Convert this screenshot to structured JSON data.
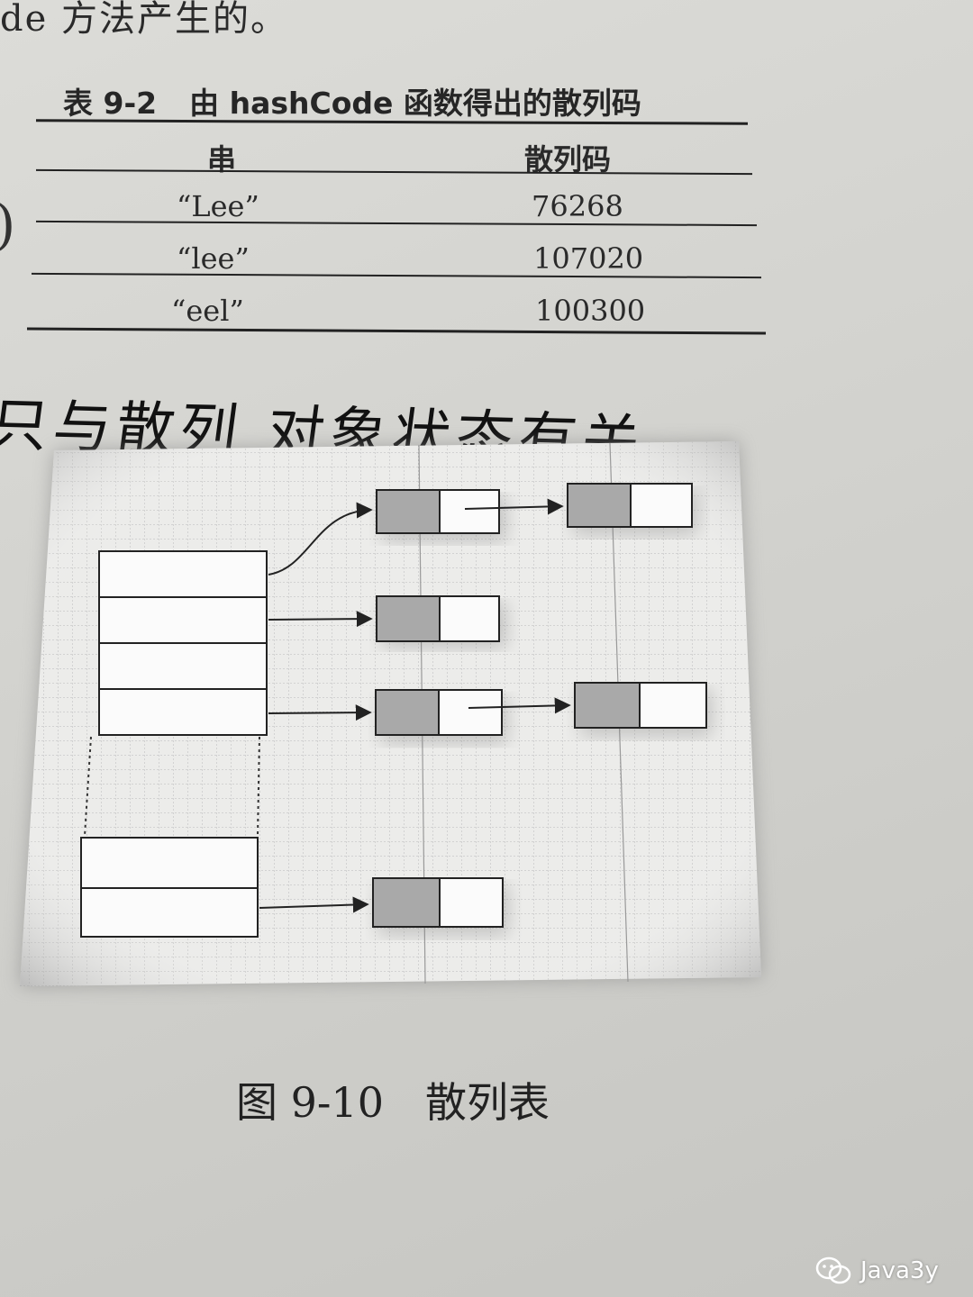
{
  "page": {
    "top_text": "de 方法产生的。",
    "handwritten_note": "只与散列 对象状态有关"
  },
  "table": {
    "caption_number": "表 9-2",
    "caption_title": "由 hashCode 函数得出的散列码",
    "headers": [
      "串",
      "散列码"
    ],
    "rows": [
      {
        "string": "“Lee”",
        "hash": "76268"
      },
      {
        "string": "“lee”",
        "hash": "107020"
      },
      {
        "string": "“eel”",
        "hash": "100300"
      }
    ]
  },
  "figure": {
    "caption_number": "图 9-10",
    "caption_title": "散列表"
  },
  "watermark": {
    "text": "Java3y"
  }
}
